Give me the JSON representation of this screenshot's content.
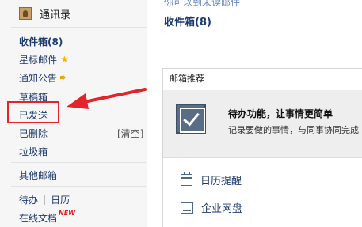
{
  "sidebar": {
    "contacts_label": "通讯录",
    "inbox_label": "收件箱(8)",
    "starred_label": "星标邮件",
    "notices_label": "通知公告",
    "drafts_label": "草稿箱",
    "sent_label": "已发送",
    "deleted_label": "已删除",
    "clear_label": "[清空]",
    "trash_label": "垃圾箱",
    "other_mailboxes_label": "其他邮箱",
    "todo_label": "待办",
    "separator": "|",
    "calendar_label": "日历",
    "online_docs_label": "在线文档",
    "new_badge": "NEW"
  },
  "main": {
    "partial_text": "你可以到未读邮件",
    "inbox_heading": "收件箱(8)",
    "recommend": {
      "title": "邮箱推荐",
      "promo_title": "待办功能，让事情更简单",
      "promo_desc": "记录要做的事情，与同事协同完成",
      "features": [
        {
          "label": "日历提醒",
          "icon": "calendar-icon"
        },
        {
          "label": "企业网盘",
          "icon": "drive-icon"
        }
      ]
    }
  },
  "annotation": {
    "highlight_color": "#e3242b"
  }
}
